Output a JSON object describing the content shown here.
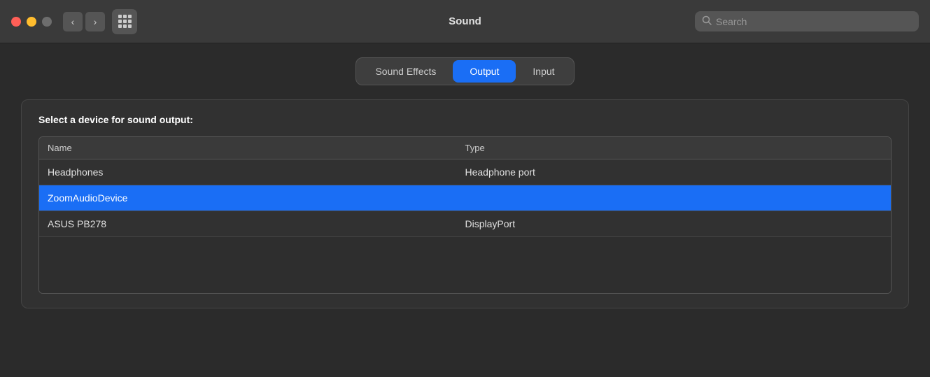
{
  "titlebar": {
    "title": "Sound",
    "search_placeholder": "Search",
    "controls": {
      "close_label": "close",
      "minimize_label": "minimize",
      "zoom_label": "zoom"
    },
    "nav": {
      "back_label": "‹",
      "forward_label": "›"
    }
  },
  "tabs": [
    {
      "id": "sound-effects",
      "label": "Sound Effects",
      "active": false
    },
    {
      "id": "output",
      "label": "Output",
      "active": true
    },
    {
      "id": "input",
      "label": "Input",
      "active": false
    }
  ],
  "device_section": {
    "title": "Select a device for sound output:",
    "table": {
      "columns": [
        {
          "id": "name",
          "label": "Name"
        },
        {
          "id": "type",
          "label": "Type"
        }
      ],
      "rows": [
        {
          "name": "Headphones",
          "type": "Headphone port",
          "selected": false
        },
        {
          "name": "ZoomAudioDevice",
          "type": "",
          "selected": true
        },
        {
          "name": "ASUS PB278",
          "type": "DisplayPort",
          "selected": false
        }
      ]
    }
  }
}
